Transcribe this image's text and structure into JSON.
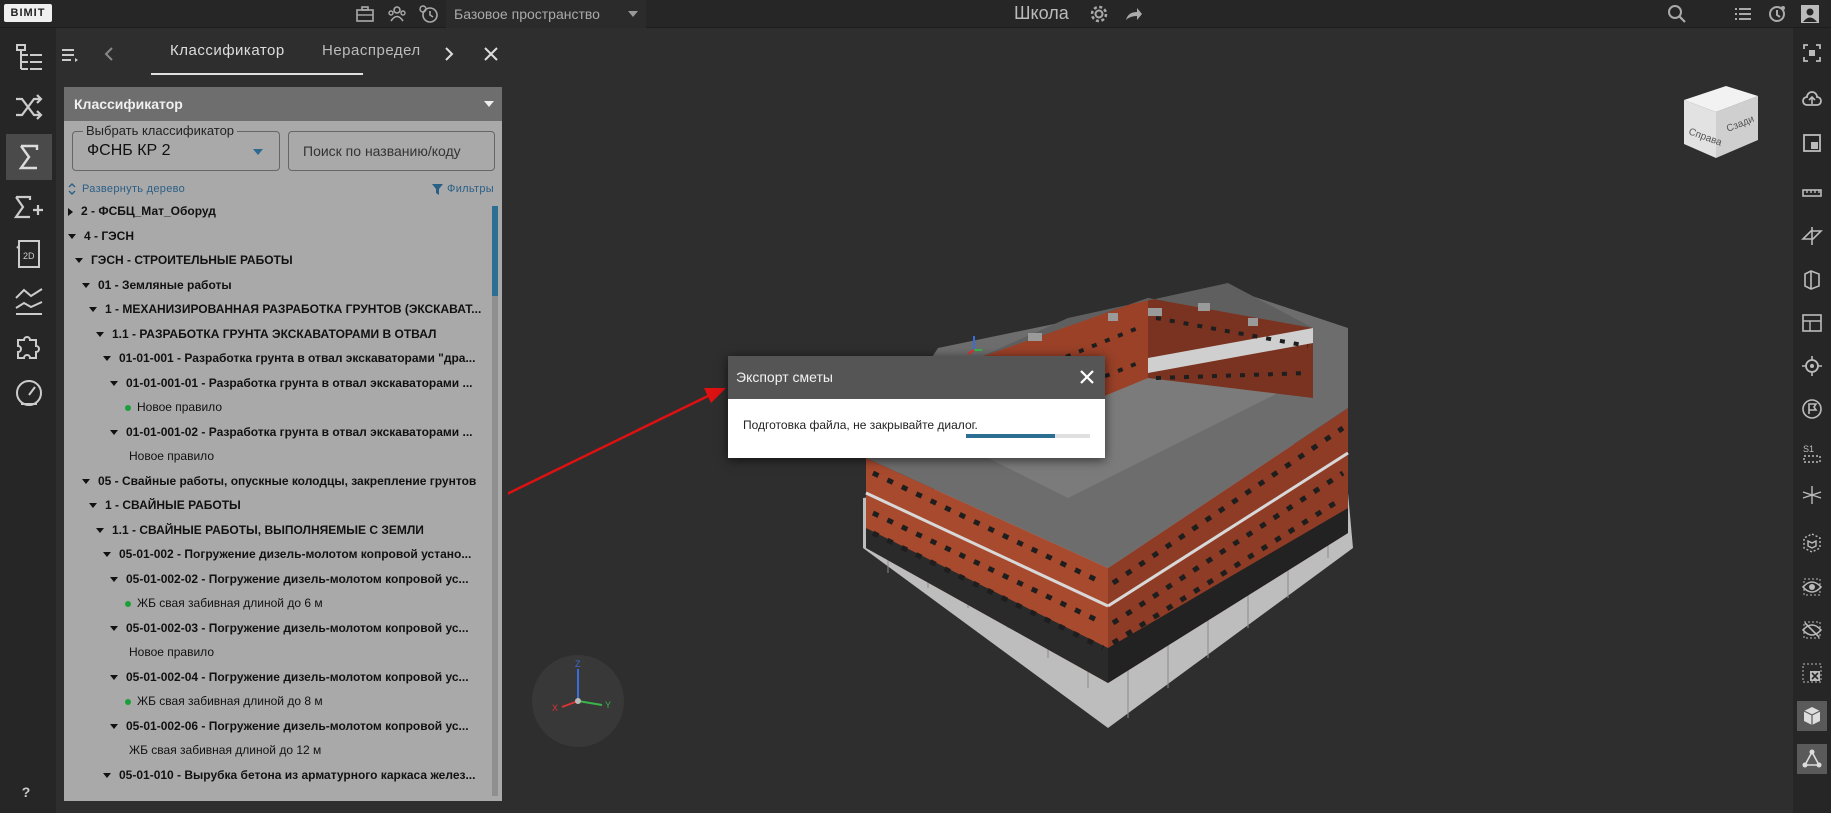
{
  "app": {
    "logo": "BIMIT",
    "space_select": "Базовое пространство",
    "project_title": "Школа"
  },
  "panel": {
    "tabs": [
      {
        "label": "Классификатор",
        "active": true
      },
      {
        "label": "Нераспредел",
        "active": false
      }
    ],
    "accordion_title": "Классификатор",
    "classifier_legend": "Выбрать классификатор",
    "classifier_value": "ФСНБ КР 2",
    "search_placeholder": "Поиск по названию/коду",
    "expand_tree": "Развернуть дерево",
    "filters": "Фильтры",
    "tree": [
      {
        "text": "2 - ФСБЦ_Мат_Оборуд",
        "level": 0,
        "arrow": "right",
        "bold": true
      },
      {
        "text": "4 - ГЭСН",
        "level": 0,
        "arrow": "down",
        "bold": true
      },
      {
        "text": "ГЭСН - СТРОИТЕЛЬНЫЕ РАБОТЫ",
        "level": 1,
        "arrow": "down",
        "bold": true
      },
      {
        "text": "01 - Земляные работы",
        "level": 2,
        "arrow": "down",
        "bold": true
      },
      {
        "text": "1 - МЕХАНИЗИРОВАННАЯ РАЗРАБОТКА ГРУНТОВ (ЭКСКАВАТ...",
        "level": 3,
        "arrow": "down",
        "bold": true
      },
      {
        "text": "1.1 - РАЗРАБОТКА ГРУНТА ЭКСКАВАТОРАМИ В ОТВАЛ",
        "level": 4,
        "arrow": "down",
        "bold": true
      },
      {
        "text": "01-01-001 - Разработка грунта в отвал экскаваторами \"дра...",
        "level": 5,
        "arrow": "down",
        "bold": true
      },
      {
        "text": "01-01-001-01 - Разработка грунта в отвал экскаваторами ...",
        "level": 6,
        "arrow": "down",
        "bold": true
      },
      {
        "text": "Новое правило",
        "level": 7,
        "dot": true
      },
      {
        "text": "01-01-001-02 - Разработка грунта в отвал экскаваторами ...",
        "level": 6,
        "arrow": "down",
        "bold": true
      },
      {
        "text": "Новое правило",
        "level": 7
      },
      {
        "text": "05 - Свайные работы, опускные колодцы, закрепление грунтов",
        "level": 2,
        "arrow": "down",
        "bold": true
      },
      {
        "text": "1 - СВАЙНЫЕ РАБОТЫ",
        "level": 3,
        "arrow": "down",
        "bold": true
      },
      {
        "text": "1.1 - СВАЙНЫЕ РАБОТЫ, ВЫПОЛНЯЕМЫЕ С ЗЕМЛИ",
        "level": 4,
        "arrow": "down",
        "bold": true
      },
      {
        "text": "05-01-002 - Погружение дизель-молотом копровой устано...",
        "level": 5,
        "arrow": "down",
        "bold": true
      },
      {
        "text": "05-01-002-02 - Погружение дизель-молотом копровой ус...",
        "level": 6,
        "arrow": "down",
        "bold": true
      },
      {
        "text": "ЖБ свая забивная длиной до 6 м",
        "level": 7,
        "dot": true
      },
      {
        "text": "05-01-002-03 - Погружение дизель-молотом копровой ус...",
        "level": 6,
        "arrow": "down",
        "bold": true
      },
      {
        "text": "Новое правило",
        "level": 7
      },
      {
        "text": "05-01-002-04 - Погружение дизель-молотом копровой ус...",
        "level": 6,
        "arrow": "down",
        "bold": true
      },
      {
        "text": "ЖБ свая забивная длиной до 8 м",
        "level": 7,
        "dot": true
      },
      {
        "text": "05-01-002-06 - Погружение дизель-молотом копровой ус...",
        "level": 6,
        "arrow": "down",
        "bold": true
      },
      {
        "text": "ЖБ свая забивная длиной до 12 м",
        "level": 7
      },
      {
        "text": "05-01-010 - Вырубка бетона из арматурного каркаса желез...",
        "level": 5,
        "arrow": "down",
        "bold": true
      }
    ]
  },
  "dialog": {
    "title": "Экспорт сметы",
    "message": "Подготовка файла, не закрывайте диалог.",
    "progress": 0.72
  },
  "cube": {
    "front": "Справа",
    "side": "Сзади"
  },
  "axes": {
    "x": "X",
    "y": "Y",
    "z": "Z"
  },
  "help": "?"
}
